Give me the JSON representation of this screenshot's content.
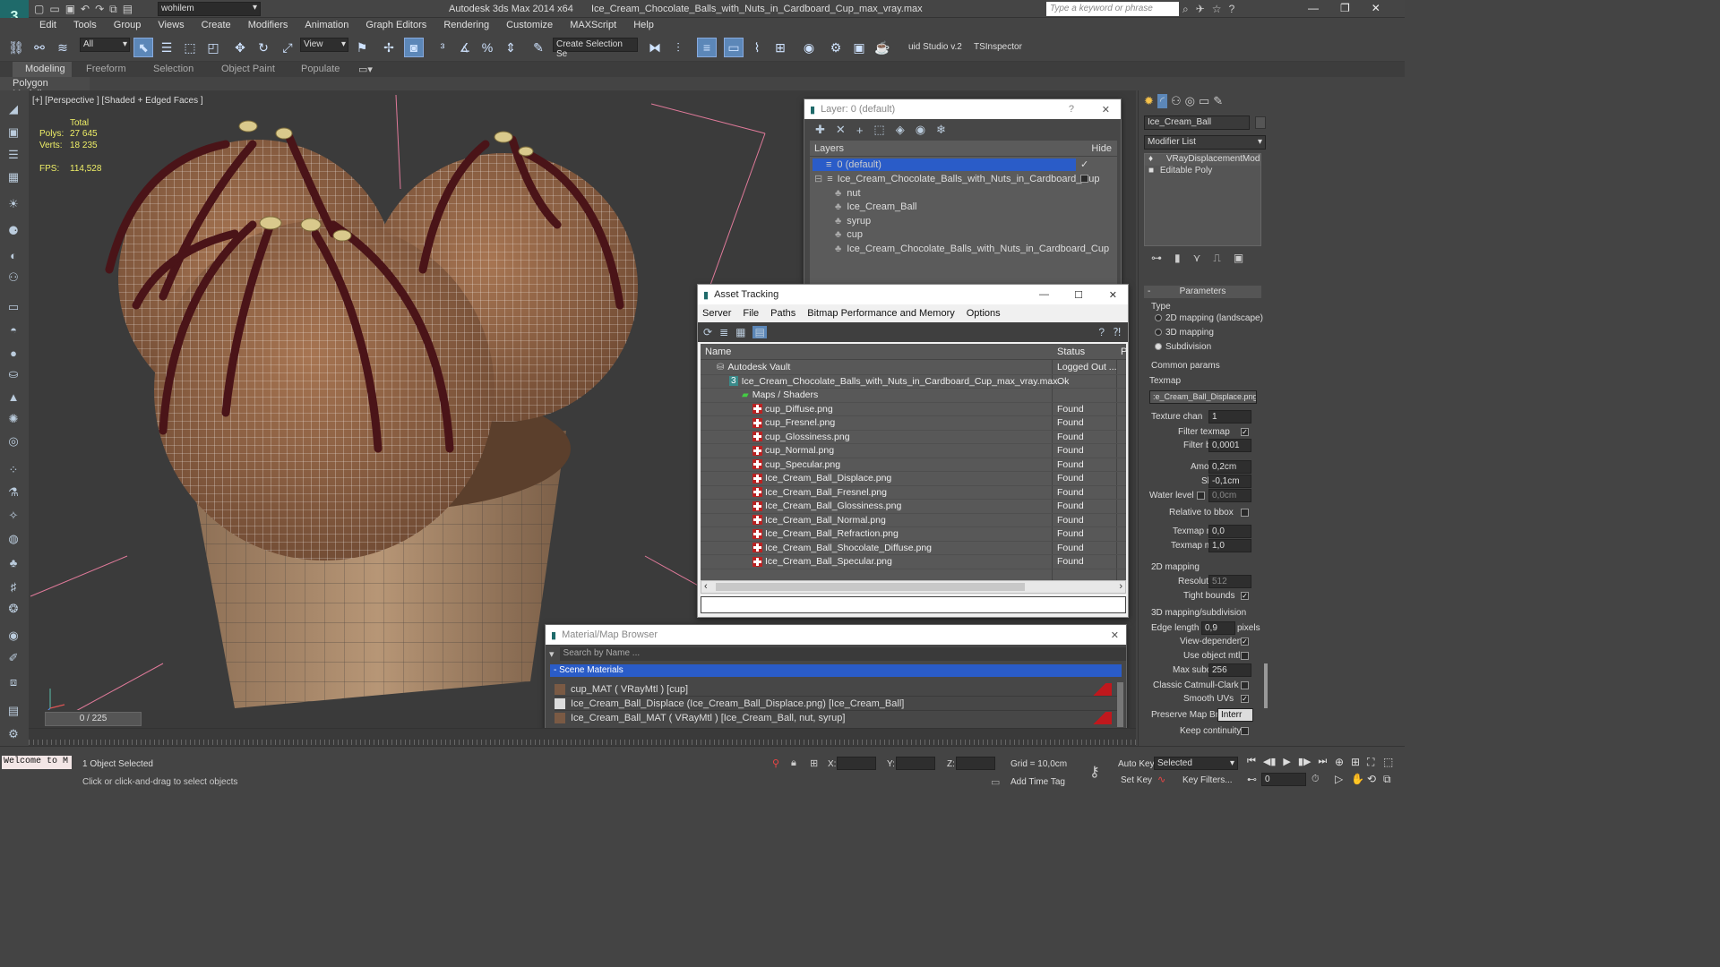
{
  "titlebar": {
    "workspace": "wohilem",
    "app_title": "Autodesk 3ds Max  2014 x64",
    "file_title": "Ice_Cream_Chocolate_Balls_with_Nuts_in_Cardboard_Cup_max_vray.max",
    "search_placeholder": "Type a keyword or phrase"
  },
  "menu": [
    "Edit",
    "Tools",
    "Group",
    "Views",
    "Create",
    "Modifiers",
    "Animation",
    "Graph Editors",
    "Rendering",
    "Customize",
    "MAXScript",
    "Help"
  ],
  "toolbar": {
    "selection_filter": "All",
    "ref_coord": "View",
    "named_selection_placeholder": "Create Selection Se",
    "plugin1": "uid Studio v.2",
    "plugin2": "TSInspector"
  },
  "ribbon": {
    "tabs": [
      "Modeling",
      "Freeform",
      "Selection",
      "Object Paint",
      "Populate"
    ],
    "sub": "Polygon Modeling"
  },
  "viewport": {
    "label": "[+] [Perspective ] [Shaded + Edged Faces ]",
    "stats_total": "Total",
    "polys_label": "Polys:",
    "polys_value": "27 645",
    "verts_label": "Verts:",
    "verts_value": "18 235",
    "fps_label": "FPS:",
    "fps_value": "114,528"
  },
  "layer_window": {
    "title": "Layer: 0 (default)",
    "col_layers": "Layers",
    "col_hide": "Hide",
    "rows": [
      {
        "name": "0 (default)",
        "selected": true
      },
      {
        "name": "Ice_Cream_Chocolate_Balls_with_Nuts_in_Cardboard_Cup",
        "selected": false
      },
      {
        "name": "nut",
        "selected": false
      },
      {
        "name": "Ice_Cream_Ball",
        "selected": false
      },
      {
        "name": "syrup",
        "selected": false
      },
      {
        "name": "cup",
        "selected": false
      },
      {
        "name": "Ice_Cream_Chocolate_Balls_with_Nuts_in_Cardboard_Cup",
        "selected": false
      }
    ]
  },
  "asset_window": {
    "title": "Asset Tracking",
    "menu": [
      "Server",
      "File",
      "Paths",
      "Bitmap Performance and Memory",
      "Options"
    ],
    "col_name": "Name",
    "col_status": "Status",
    "col_p": "P",
    "rows": [
      {
        "name": "Autodesk Vault",
        "status": "Logged Out ..."
      },
      {
        "name": "Ice_Cream_Chocolate_Balls_with_Nuts_in_Cardboard_Cup_max_vray.max",
        "status": "Ok"
      },
      {
        "name": "Maps / Shaders",
        "status": ""
      },
      {
        "name": "cup_Diffuse.png",
        "status": "Found"
      },
      {
        "name": "cup_Fresnel.png",
        "status": "Found"
      },
      {
        "name": "cup_Glossiness.png",
        "status": "Found"
      },
      {
        "name": "cup_Normal.png",
        "status": "Found"
      },
      {
        "name": "cup_Specular.png",
        "status": "Found"
      },
      {
        "name": "Ice_Cream_Ball_Displace.png",
        "status": "Found"
      },
      {
        "name": "Ice_Cream_Ball_Fresnel.png",
        "status": "Found"
      },
      {
        "name": "Ice_Cream_Ball_Glossiness.png",
        "status": "Found"
      },
      {
        "name": "Ice_Cream_Ball_Normal.png",
        "status": "Found"
      },
      {
        "name": "Ice_Cream_Ball_Refraction.png",
        "status": "Found"
      },
      {
        "name": "Ice_Cream_Ball_Shocolate_Diffuse.png",
        "status": "Found"
      },
      {
        "name": "Ice_Cream_Ball_Specular.png",
        "status": "Found"
      }
    ]
  },
  "material_window": {
    "title": "Material/Map Browser",
    "search_placeholder": "Search by Name ...",
    "section": "- Scene Materials",
    "items": [
      "cup_MAT  ( VRayMtl ) [cup]",
      "Ice_Cream_Ball_Displace (Ice_Cream_Ball_Displace.png) [Ice_Cream_Ball]",
      "Ice_Cream_Ball_MAT  ( VRayMtl ) [Ice_Cream_Ball, nut, syrup]"
    ]
  },
  "command_panel": {
    "object_name": "Ice_Cream_Ball",
    "modifier_list": "Modifier List",
    "stack": [
      "VRayDisplacementMod",
      "Editable Poly"
    ],
    "rollout": "Parameters",
    "type_label": "Type",
    "type_options": [
      "2D mapping (landscape)",
      "3D mapping",
      "Subdivision"
    ],
    "common_params": "Common params",
    "texmap_label": "Texmap",
    "texmap_value": ":e_Cream_Ball_Displace.png)",
    "texture_chan_label": "Texture chan",
    "texture_chan_value": "1",
    "filter_texmap_label": "Filter texmap",
    "filter_blur_label": "Filter blur",
    "filter_blur_value": "0,0001",
    "amount_label": "Amount",
    "amount_value": "0,2cm",
    "shift_label": "Shift",
    "shift_value": "-0,1cm",
    "water_level_label": "Water level",
    "water_level_value": "0,0cm",
    "relative_bbox_label": "Relative to bbox",
    "texmap_min_label": "Texmap min",
    "texmap_min_value": "0,0",
    "texmap_max_label": "Texmap max",
    "texmap_max_value": "1,0",
    "mapping2d_label": "2D mapping",
    "resolution_label": "Resolution",
    "resolution_value": "512",
    "tight_bounds_label": "Tight bounds",
    "mapping3d_label": "3D mapping/subdivision",
    "edge_length_label": "Edge length",
    "edge_length_value": "0,9",
    "pixels_label": "pixels",
    "view_dependent_label": "View-dependent",
    "use_object_mtl_label": "Use object mtl",
    "max_subdivs_label": "Max subdivs",
    "max_subdivs_value": "256",
    "classic_cc_label": "Classic Catmull-Clark",
    "smooth_uvs_label": "Smooth UVs",
    "preserve_map_label": "Preserve Map Bnd",
    "preserve_map_value": "Interr",
    "keep_continuity_label": "Keep continuity"
  },
  "timeline": {
    "frame": "0 / 225"
  },
  "status": {
    "maxscript": "Welcome to M",
    "selection": "1 Object Selected",
    "prompt": "Click or click-and-drag to select objects",
    "x_label": "X:",
    "y_label": "Y:",
    "z_label": "Z:",
    "grid": "Grid = 10,0cm",
    "add_time_tag": "Add Time Tag",
    "auto_key": "Auto Key",
    "set_key": "Set Key",
    "selected": "Selected",
    "key_filters": "Key Filters...",
    "frame_value": "0"
  },
  "colors": {
    "accent": "#5c87b8",
    "selection_blue": "#2a5cc8",
    "found_icon": "#b22222"
  }
}
